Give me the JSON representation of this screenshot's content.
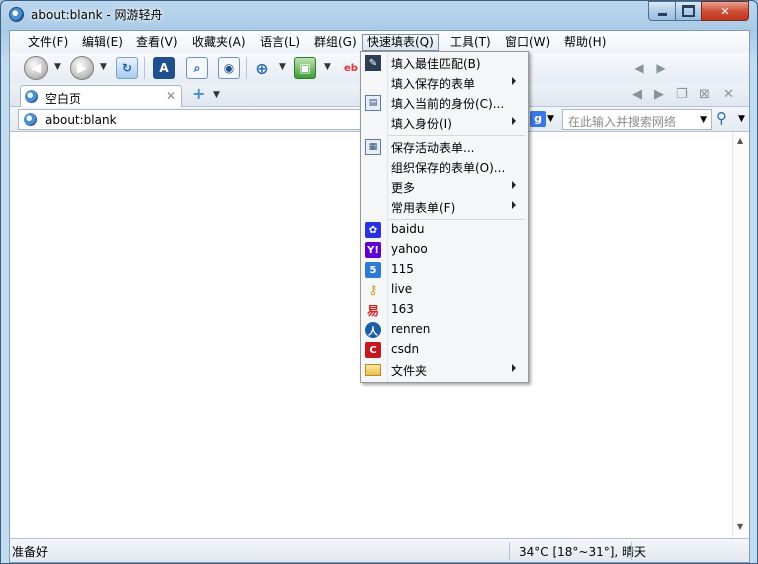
{
  "window": {
    "title": "about:blank - 网游轻舟"
  },
  "menubar": {
    "items": [
      "文件(F)",
      "编辑(E)",
      "查看(V)",
      "收藏夹(A)",
      "语言(L)",
      "群组(G)",
      "快速填表(Q)",
      "工具(T)",
      "窗口(W)",
      "帮助(H)"
    ]
  },
  "tabs": [
    {
      "label": "空白页"
    }
  ],
  "address": {
    "value": "about:blank"
  },
  "search": {
    "placeholder": "在此输入并搜索网络"
  },
  "status": {
    "text": "准备好",
    "weather": "34°C [18°~31°], 晴天"
  },
  "dropdown": {
    "items": [
      {
        "label": "填入最佳匹配(B)",
        "icon": "form-fill-icon",
        "submenu": false
      },
      {
        "label": "填入保存的表单",
        "icon": "",
        "submenu": true
      },
      {
        "label": "填入当前的身份(C)...",
        "icon": "identity-card-icon",
        "submenu": false
      },
      {
        "label": "填入身份(I)",
        "icon": "",
        "submenu": true
      },
      {
        "label": "保存活动表单...",
        "icon": "save-form-icon",
        "submenu": false
      },
      {
        "label": "组织保存的表单(O)...",
        "icon": "",
        "submenu": false
      },
      {
        "label": "更多",
        "icon": "",
        "submenu": true
      },
      {
        "label": "常用表单(F)",
        "icon": "",
        "submenu": true
      },
      {
        "label": "baidu",
        "icon": "baidu-icon",
        "submenu": false
      },
      {
        "label": "yahoo",
        "icon": "yahoo-icon",
        "submenu": false
      },
      {
        "label": "115",
        "icon": "115-icon",
        "submenu": false
      },
      {
        "label": "live",
        "icon": "key-icon",
        "submenu": false
      },
      {
        "label": "163",
        "icon": "163-icon",
        "submenu": false
      },
      {
        "label": "renren",
        "icon": "renren-icon",
        "submenu": false
      },
      {
        "label": "csdn",
        "icon": "csdn-icon",
        "submenu": false
      },
      {
        "label": "文件夹",
        "icon": "folder-icon",
        "submenu": true
      }
    ]
  },
  "colors": {
    "menu_bg": "#f5f6f7",
    "menu_border": "#979797",
    "link_blue": "#2b6cb4"
  }
}
